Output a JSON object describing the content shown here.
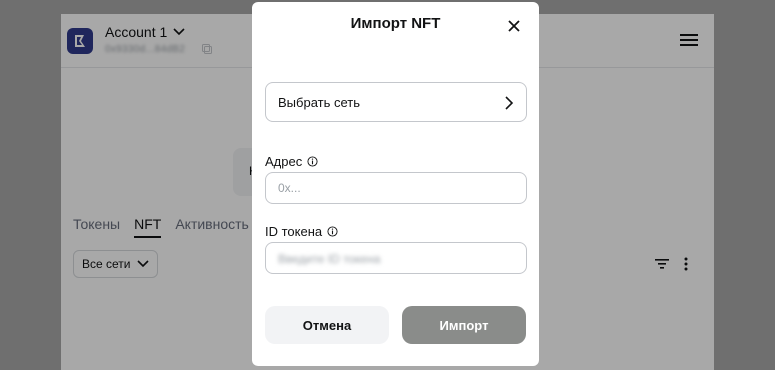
{
  "account": {
    "name": "Account 1",
    "address": "0x9330d...84dB2"
  },
  "center_card": {
    "letter": "К"
  },
  "tabs": [
    {
      "label": "Токены",
      "active": false
    },
    {
      "label": "NFT",
      "active": true
    },
    {
      "label": "Активность",
      "active": false
    }
  ],
  "filter": {
    "label": "Все сети"
  },
  "modal": {
    "title": "Импорт NFT",
    "network_select_label": "Выбрать сеть",
    "address_label": "Адрес",
    "address_placeholder": "0x...",
    "token_id_label": "ID токена",
    "token_id_placeholder": "Введите ID токена",
    "cancel_label": "Отмена",
    "import_label": "Импорт"
  },
  "icons": {
    "logo": "account-logo-icon",
    "chevron_down": "chevron-down-icon",
    "copy": "copy-icon",
    "menu": "hamburger-menu-icon",
    "sort": "sort-icon",
    "kebab": "kebab-menu-icon",
    "close": "close-icon",
    "chevron_right": "chevron-right-icon",
    "info": "info-icon"
  },
  "colors": {
    "primary_text": "#121314",
    "import_button_bg": "#8a8c8a",
    "cancel_button_bg": "#f2f3f5",
    "overlay": "rgba(0,0,0,0.34)"
  }
}
